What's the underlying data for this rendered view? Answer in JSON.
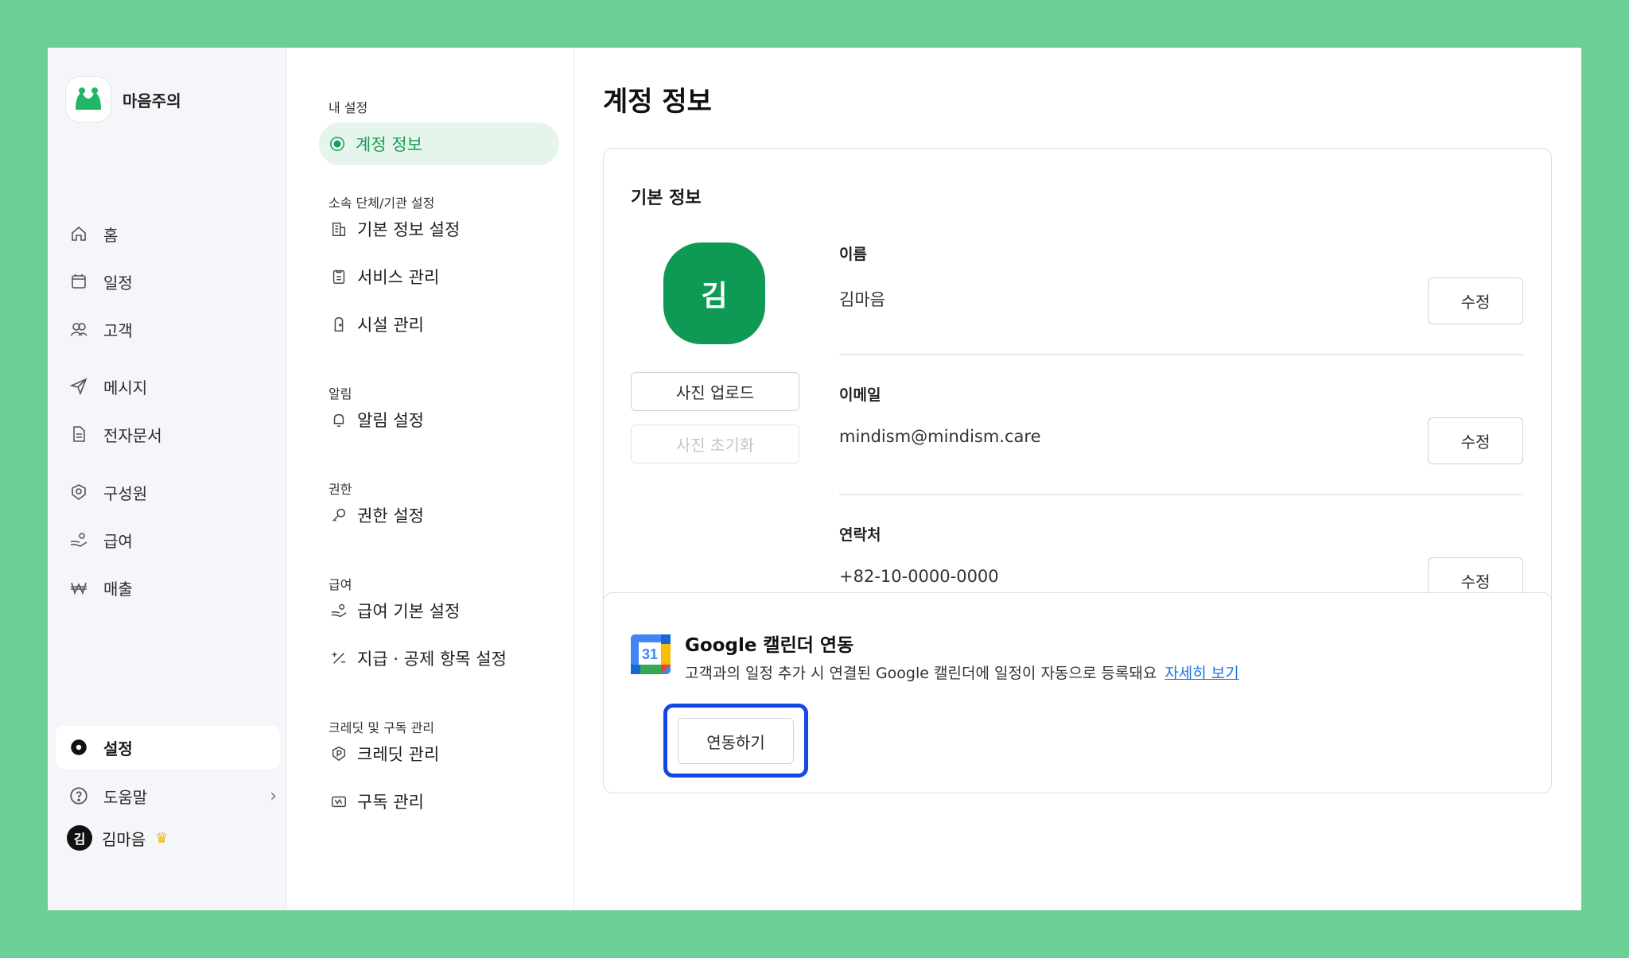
{
  "brand": {
    "name": "마음주의"
  },
  "nav": {
    "items": [
      {
        "label": "홈",
        "icon": "home-icon"
      },
      {
        "label": "일정",
        "icon": "calendar-icon"
      },
      {
        "label": "고객",
        "icon": "users-icon"
      },
      {
        "label": "메시지",
        "icon": "send-icon"
      },
      {
        "label": "전자문서",
        "icon": "document-icon"
      },
      {
        "label": "구성원",
        "icon": "member-icon"
      },
      {
        "label": "급여",
        "icon": "salary-icon"
      },
      {
        "label": "매출",
        "icon": "won-icon"
      }
    ],
    "settings_label": "설정",
    "help_label": "도움말",
    "user_name": "김마음",
    "user_initial": "김"
  },
  "settings_menu": {
    "section_my": "내 설정",
    "account_info": "계정 정보",
    "section_org": "소속 단체/기관 설정",
    "basic_info_settings": "기본 정보 설정",
    "service_manage": "서비스 관리",
    "facility_manage": "시설 관리",
    "section_notice": "알림",
    "notice_settings": "알림 설정",
    "section_perm": "권한",
    "perm_settings": "권한 설정",
    "section_salary": "급여",
    "salary_basic": "급여 기본 설정",
    "pay_deduct": "지급 · 공제 항목 설정",
    "section_credit": "크레딧 및 구독 관리",
    "credit_manage": "크레딧 관리",
    "subscription_manage": "구독 관리"
  },
  "main": {
    "title": "계정 정보",
    "basic": {
      "title": "기본 정보",
      "avatar_initial": "김",
      "upload_photo": "사진 업로드",
      "reset_photo": "사진 초기화",
      "name_label": "이름",
      "name_value": "김마음",
      "email_label": "이메일",
      "email_value": "mindism@mindism.care",
      "phone_label": "연락처",
      "phone_value": "+82-10-0000-0000",
      "edit_label": "수정"
    },
    "google": {
      "calendar_day": "31",
      "title": "Google 캘린더 연동",
      "desc": "고객과의 일정 추가 시 연결된 Google 캘린더에 일정이 자동으로 등록돼요",
      "link": "자세히 보기",
      "connect_label": "연동하기"
    }
  },
  "colors": {
    "background": "#6ccf96",
    "accent_green": "#0e9a55",
    "highlight_blue": "#1446e8",
    "link_blue": "#1a73e8"
  }
}
